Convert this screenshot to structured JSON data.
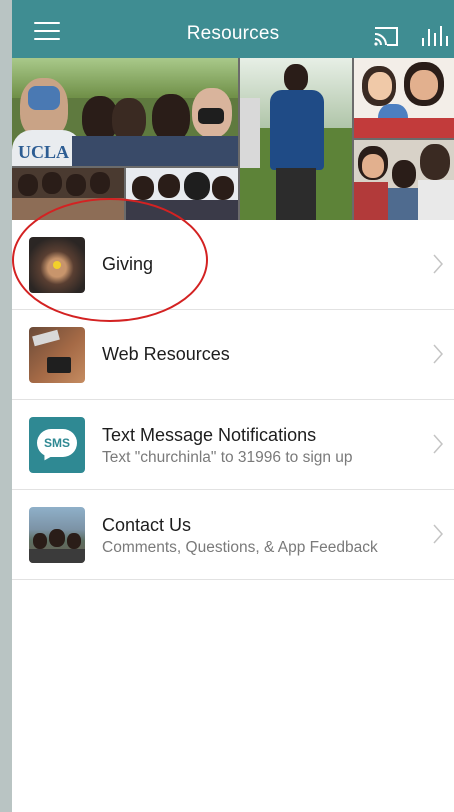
{
  "header": {
    "title": "Resources",
    "menu_icon": "hamburger-menu-icon",
    "cast_icon": "cast-icon",
    "audio_icon": "audio-bars-icon",
    "color": "#3f8d92"
  },
  "collage": {
    "photos": [
      {
        "name": "group-selfie-photo"
      },
      {
        "name": "outdoor-activity-photo"
      },
      {
        "name": "family-photo"
      },
      {
        "name": "small-group-photo-1"
      },
      {
        "name": "small-group-photo-2"
      },
      {
        "name": "family-photo-2"
      }
    ],
    "shirt_text": "UCLA"
  },
  "list": {
    "items": [
      {
        "title": "Giving",
        "subtitle": "",
        "thumb": "giving-hands-thumbnail"
      },
      {
        "title": "Web Resources",
        "subtitle": "",
        "thumb": "desk-laptop-thumbnail"
      },
      {
        "title": "Text Message Notifications",
        "subtitle": "Text \"churchinla\" to 31996 to sign up",
        "thumb": "sms-icon",
        "thumb_label": "SMS"
      },
      {
        "title": "Contact Us",
        "subtitle": "Comments, Questions, & App Feedback",
        "thumb": "group-mountain-thumbnail"
      }
    ]
  },
  "annotation": {
    "color": "#d32222"
  }
}
